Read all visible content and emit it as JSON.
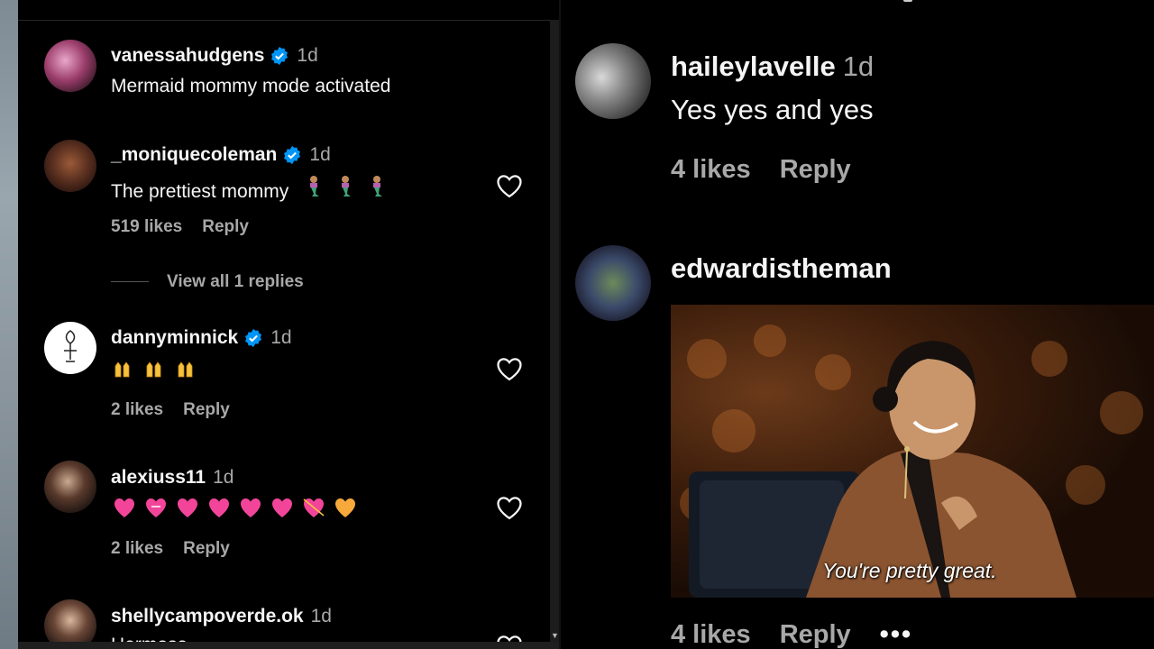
{
  "left": {
    "comments": [
      {
        "username": "vanessahudgens",
        "verified": true,
        "time": "1d",
        "text": "Mermaid mommy mode activated"
      },
      {
        "username": "_moniquecoleman",
        "verified": true,
        "time": "1d",
        "text": "The prettiest mommy",
        "emoji": [
          "merperson",
          "merperson",
          "merperson"
        ],
        "likes": "519 likes",
        "reply": "Reply",
        "view_replies": "View all 1 replies"
      },
      {
        "username": "dannyminnick",
        "verified": true,
        "time": "1d",
        "emoji": [
          "raising-hands",
          "raising-hands",
          "raising-hands"
        ],
        "likes": "2 likes",
        "reply": "Reply"
      },
      {
        "username": "alexiuss11",
        "verified": false,
        "time": "1d",
        "emoji": [
          "pink-heart",
          "heart-with-ribbon",
          "heart-decoration",
          "revolving-hearts",
          "two-hearts",
          "sparkling-heart",
          "heart-with-arrow",
          "heart-gift"
        ],
        "likes": "2 likes",
        "reply": "Reply"
      },
      {
        "username": "shellycampoverde.ok",
        "verified": false,
        "time": "1d",
        "text": "Hermosa"
      }
    ]
  },
  "right": {
    "comments": [
      {
        "username": "haileylavelle",
        "time": "1d",
        "text": "Yes yes and yes",
        "likes": "4 likes",
        "reply": "Reply"
      },
      {
        "username": "edwardistheman",
        "gif_caption": "You're pretty great.",
        "likes": "4 likes",
        "reply": "Reply",
        "more": "•••"
      }
    ]
  },
  "colors": {
    "background": "#000000",
    "text": "#f5f5f5",
    "muted": "#a8a8a8",
    "verified": "#0095f6"
  },
  "icons": [
    "verified-badge-icon",
    "heart-outline-icon",
    "more-options-icon"
  ]
}
